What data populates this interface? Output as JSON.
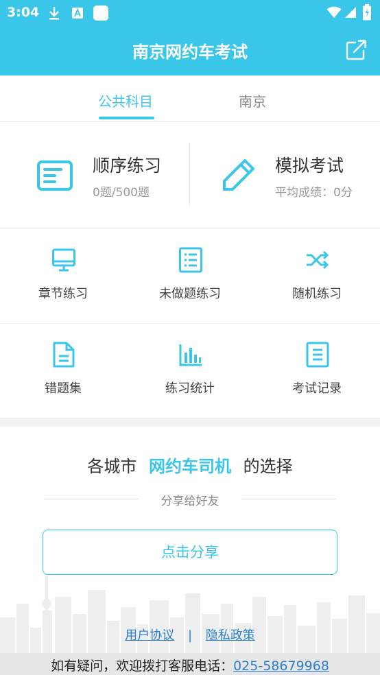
{
  "status_bar": {
    "time": "3:04"
  },
  "app_bar": {
    "title": "南京网约车考试"
  },
  "tabs": [
    {
      "label": "公共科目",
      "active": true
    },
    {
      "label": "南京",
      "active": false
    }
  ],
  "main_cards": [
    {
      "title": "顺序练习",
      "subtitle": "0题/500题",
      "icon": "document-card-icon"
    },
    {
      "title": "模拟考试",
      "subtitle": "平均成绩：0分",
      "icon": "pencil-icon"
    }
  ],
  "grid": [
    {
      "label": "章节练习",
      "icon": "monitor-icon"
    },
    {
      "label": "未做题练习",
      "icon": "list-icon"
    },
    {
      "label": "随机练习",
      "icon": "shuffle-icon"
    },
    {
      "label": "错题集",
      "icon": "file-icon"
    },
    {
      "label": "练习统计",
      "icon": "bar-chart-icon"
    },
    {
      "label": "考试记录",
      "icon": "record-icon"
    }
  ],
  "share": {
    "slogan_prefix": "各城市",
    "slogan_highlight": "网约车司机",
    "slogan_suffix": "的选择",
    "subtitle": "分享给好友",
    "button": "点击分享"
  },
  "footer": {
    "user_agreement": "用户协议",
    "separator": "|",
    "privacy_policy": "隐私政策",
    "contact_prefix": "如有疑问，欢迎拨打客服电话：",
    "phone": "025-58679968"
  },
  "colors": {
    "accent": "#3ac6e8",
    "link": "#2b7fd0"
  }
}
